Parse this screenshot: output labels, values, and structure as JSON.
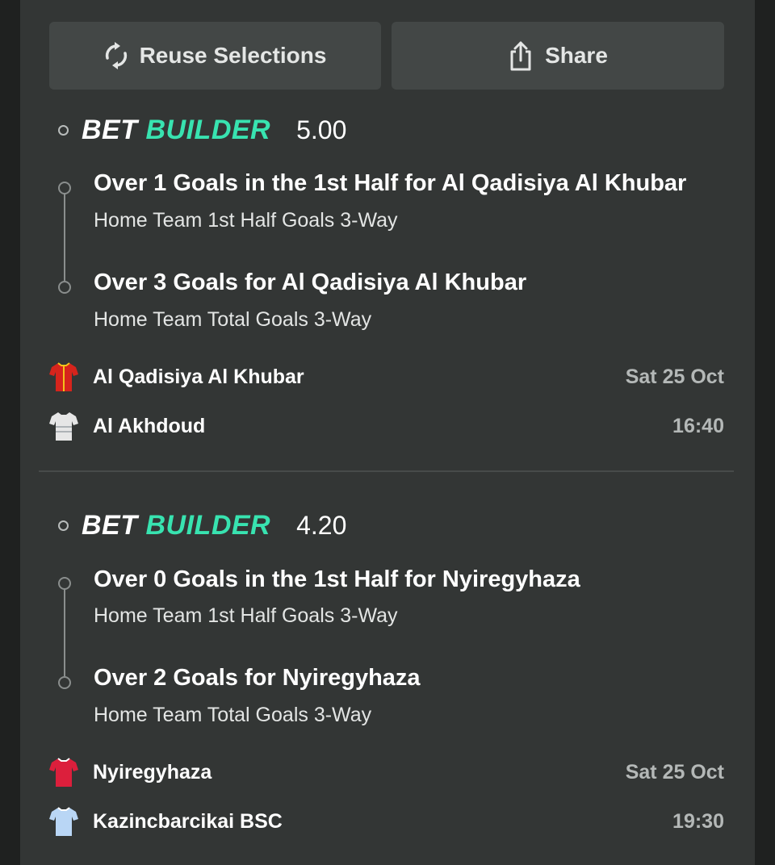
{
  "actions": {
    "reuse_label": "Reuse Selections",
    "share_label": "Share"
  },
  "bets": [
    {
      "tag_bet": "BET",
      "tag_builder": "BUILDER",
      "odds": "5.00",
      "selections": [
        {
          "title": "Over 1 Goals in the 1st Half for Al Qadisiya Al Khubar",
          "market": "Home Team 1st Half Goals 3-Way"
        },
        {
          "title": "Over 3 Goals for Al Qadisiya Al Khubar",
          "market": "Home Team Total Goals 3-Way"
        }
      ],
      "home_team": "Al Qadisiya Al Khubar",
      "away_team": "Al Akhdoud",
      "date": "Sat 25 Oct",
      "time": "16:40",
      "home_jersey_color": "#d6241c",
      "away_jersey_color": "#e6e6e6"
    },
    {
      "tag_bet": "BET",
      "tag_builder": "BUILDER",
      "odds": "4.20",
      "selections": [
        {
          "title": "Over 0 Goals in the 1st Half for Nyiregyhaza",
          "market": "Home Team 1st Half Goals 3-Way"
        },
        {
          "title": "Over 2 Goals for Nyiregyhaza",
          "market": "Home Team Total Goals 3-Way"
        }
      ],
      "home_team": "Nyiregyhaza",
      "away_team": "Kazincbarcikai BSC",
      "date": "Sat 25 Oct",
      "time": "19:30",
      "home_jersey_color": "#dc1f3c",
      "away_jersey_color": "#b9d6f5"
    }
  ],
  "colors": {
    "accent": "#38e3b0",
    "panel": "#333635",
    "button": "#434746"
  }
}
